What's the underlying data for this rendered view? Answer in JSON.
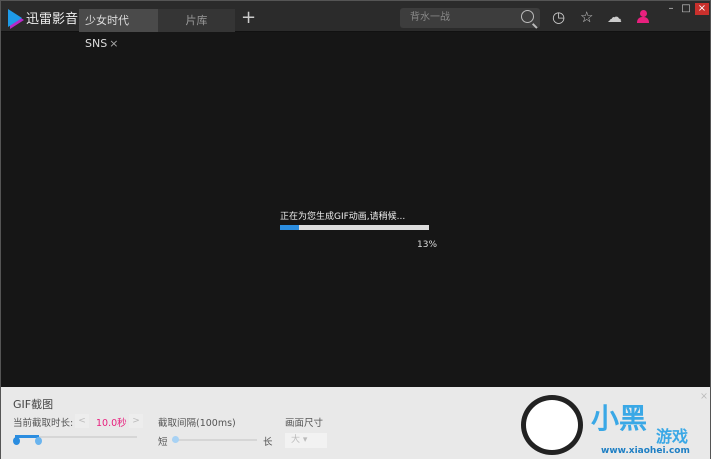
{
  "app": {
    "name": "迅雷影音"
  },
  "tabs": [
    {
      "label": "少女时代SNS",
      "close": "×"
    },
    {
      "label": "片库"
    }
  ],
  "new_tab": "+",
  "search": {
    "placeholder": "背水一战"
  },
  "player": {
    "status": "正在为您生成GIF动画,请稍候...",
    "progress_percent": 13,
    "progress_label": "13%"
  },
  "gif_panel": {
    "title": "GIF截图",
    "duration_label": "当前截取时长:",
    "duration_value": "10.0秒",
    "prev": "<",
    "next": ">",
    "interval_label": "截取间隔(100ms)",
    "short": "短",
    "long": "长",
    "size_label": "画面尺寸",
    "size_value": "大",
    "close": "×"
  },
  "window": {
    "minimize": "–",
    "maximize": "□",
    "close": "×"
  },
  "watermark": {
    "text": "小黑游戏",
    "url": "www.xiaohei.com"
  },
  "colors": {
    "accent": "#2b8de0",
    "pink": "#e8207e"
  }
}
